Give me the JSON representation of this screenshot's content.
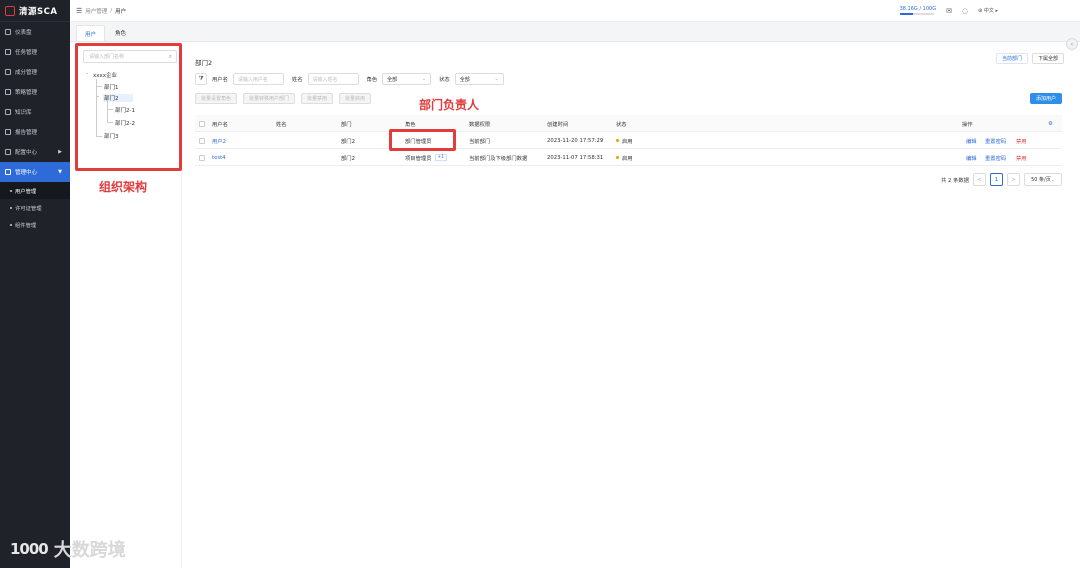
{
  "app": {
    "logo_text": "清源SCA"
  },
  "sidebar": {
    "items": [
      {
        "label": "仪表盘",
        "icon": "dashboard-icon"
      },
      {
        "label": "任务管理",
        "icon": "task-icon"
      },
      {
        "label": "成分管理",
        "icon": "component-icon"
      },
      {
        "label": "策略管理",
        "icon": "policy-icon"
      },
      {
        "label": "知识库",
        "icon": "knowledge-icon"
      },
      {
        "label": "报告管理",
        "icon": "report-icon"
      },
      {
        "label": "配置中心",
        "icon": "config-icon"
      },
      {
        "label": "管理中心",
        "icon": "admin-icon"
      }
    ],
    "sub_items": [
      {
        "label": "用户管理"
      },
      {
        "label": "许可证管理"
      },
      {
        "label": "组件管理"
      }
    ]
  },
  "topbar": {
    "breadcrumb_parent": "用户管理",
    "breadcrumb_sep": "/",
    "breadcrumb_current": "用户",
    "quota_text": "38.16G / 100G",
    "quota_fraction": 0.38,
    "language": "中文"
  },
  "tabs": [
    {
      "label": "用户"
    },
    {
      "label": "角色"
    }
  ],
  "tree": {
    "search_placeholder": "请输入部门名称",
    "nodes": [
      {
        "label": "xxxx企业"
      },
      {
        "label": "部门1"
      },
      {
        "label": "部门2"
      },
      {
        "label": "部门2-1"
      },
      {
        "label": "部门2-2"
      },
      {
        "label": "部门3"
      }
    ]
  },
  "annotations": {
    "org": "组织架构",
    "head": "部门负责人"
  },
  "main": {
    "dept_title": "部门2",
    "current_dept_button": "当前部门",
    "all_dept_button": "下属全部",
    "filter": {
      "username_label": "用户名",
      "username_placeholder": "请输入用户名",
      "name_label": "姓名",
      "name_placeholder": "请输入姓名",
      "role_label": "角色",
      "role_value": "全部",
      "status_label": "状态",
      "status_value": "全部"
    },
    "bulk_buttons": [
      {
        "label": "批量设置角色"
      },
      {
        "label": "批量转移用户部门"
      },
      {
        "label": "批量禁用"
      },
      {
        "label": "批量启用"
      }
    ],
    "add_user_button": "添加用户",
    "columns": [
      "用户名",
      "姓名",
      "部门",
      "角色",
      "数据权限",
      "创建时间",
      "状态",
      "操作"
    ],
    "rows": [
      {
        "username": "用户2",
        "name": "",
        "dept": "部门2",
        "role": "部门管理员",
        "role_extra": "",
        "scope": "当前部门",
        "created": "2023-11-20 17:57:29",
        "status": "启用",
        "actions": [
          "编辑",
          "重置密码",
          "禁用"
        ]
      },
      {
        "username": "test4",
        "name": "",
        "dept": "部门2",
        "role": "项目管理员",
        "role_extra": "+1",
        "scope": "当前部门及下级部门数据",
        "created": "2023-11-07 17:58:31",
        "status": "启用",
        "actions": [
          "编辑",
          "重置密码",
          "禁用"
        ]
      }
    ],
    "pager": {
      "total_text": "共 2 条数据",
      "prev": "<",
      "page": "1",
      "next": ">",
      "page_size": "50 条/页"
    }
  },
  "watermark": {
    "logo": "1000",
    "text": "大数跨境"
  }
}
